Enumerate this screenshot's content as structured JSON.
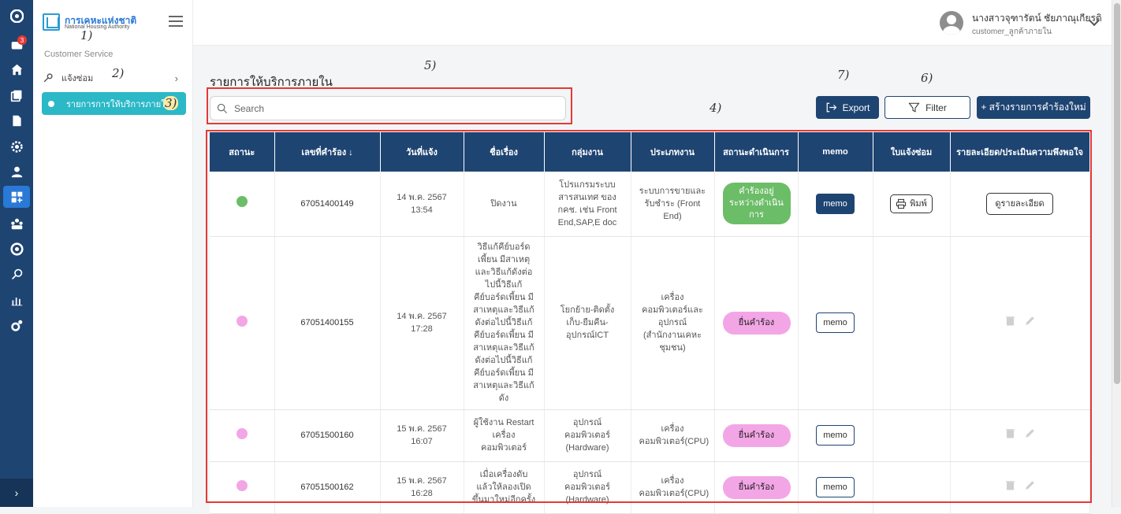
{
  "rail": {
    "badge": "3",
    "expand_glyph": "›"
  },
  "sidemenu": {
    "logo_th": "การเคหะแห่งชาติ",
    "logo_en": "National Housing Authority",
    "section": "Customer Service",
    "repair": "แจ้งซ่อม",
    "active_item": "รายการการให้บริการภายใน"
  },
  "user": {
    "name": "นางสาวจุฑารัตน์ ชัยภาณุเกียรติ",
    "role": "customer_ลูกค้าภายใน"
  },
  "annotations": [
    "1)",
    "2)",
    "3)",
    "4)",
    "5)",
    "6)",
    "7)"
  ],
  "page": {
    "title": "รายการให้บริการภายใน",
    "search_placeholder": "Search"
  },
  "buttons": {
    "export": "Export",
    "filter": "Filter",
    "new": "+ สร้างรายการคำร้องใหม่"
  },
  "colors": {
    "navy": "#1e4472",
    "teal": "#2bb8c7",
    "status_green": "#6cbd68",
    "status_pink": "#f3a6e6",
    "annotation_red": "#e53935"
  },
  "table": {
    "headers": [
      "สถานะ",
      "เลขที่คำร้อง ↓",
      "วันที่แจ้ง",
      "ชื่อเรื่อง",
      "กลุ่มงาน",
      "ประเภทงาน",
      "สถานะดำเนินการ",
      "memo",
      "ใบแจ้งซ่อม",
      "รายละเอียด/ประเมินความพึงพอใจ"
    ],
    "rows": [
      {
        "status_color": "#6cbd68",
        "id": "67051400149",
        "date": "14 พ.ค. 2567",
        "time": "13:54",
        "subject": "ปิดงาน",
        "group": "โปรแกรมระบบสารสนเทศ ของ กคช. เช่น Front End,SAP,E doc",
        "type": "ระบบการขายและรับชำระ (Front End)",
        "progress": "คำร้องอยู่ระหว่างดำเนินการ",
        "memo": "memo",
        "print": "พิมพ์",
        "detail": "ดูรายละเอียด"
      },
      {
        "status_color": "#f3a6e6",
        "id": "67051400155",
        "date": "14 พ.ค. 2567",
        "time": "17:28",
        "subject": "วิธีแก้คีย์บอร์ดเพี้ยน มีสาเหตุและวิธีแก้ดังต่อไปนี้วิธีแก้คีย์บอร์ดเพี้ยน มีสาเหตุและวิธีแก้ดังต่อไปนี้วิธีแก้คีย์บอร์ดเพี้ยน มีสาเหตุและวิธีแก้ดังต่อไปนี้วิธีแก้คีย์บอร์ดเพี้ยน มีสาเหตุและวิธีแก้ดัง",
        "group": "โยกย้าย-ติดตั้งเก็บ-ยืมคืน-อุปกรณ์ICT",
        "type": "เครื่องคอมพิวเตอร์และอุปกรณ์ (สำนักงานเคหะชุมชน)",
        "progress": "ยื่นคำร้อง",
        "memo": "memo"
      },
      {
        "status_color": "#f3a6e6",
        "id": "67051500160",
        "date": "15 พ.ค. 2567",
        "time": "16:07",
        "subject": "ผู้ใช้งาน Restart เครื่องคอมพิวเตอร์",
        "group": "อุปกรณ์คอมพิวเตอร์ (Hardware)",
        "type": "เครื่องคอมพิวเตอร์(CPU)",
        "progress": "ยื่นคำร้อง",
        "memo": "memo"
      },
      {
        "status_color": "#f3a6e6",
        "id": "67051500162",
        "date": "15 พ.ค. 2567",
        "time": "16:28",
        "subject": "เมื่อเครื่องดับ แล้วให้ลองเปิดขึ้นมาใหม่อีกครั้ง",
        "group": "อุปกรณ์คอมพิวเตอร์ (Hardware)",
        "type": "เครื่องคอมพิวเตอร์(CPU)",
        "progress": "ยื่นคำร้อง",
        "memo": "memo"
      }
    ]
  }
}
